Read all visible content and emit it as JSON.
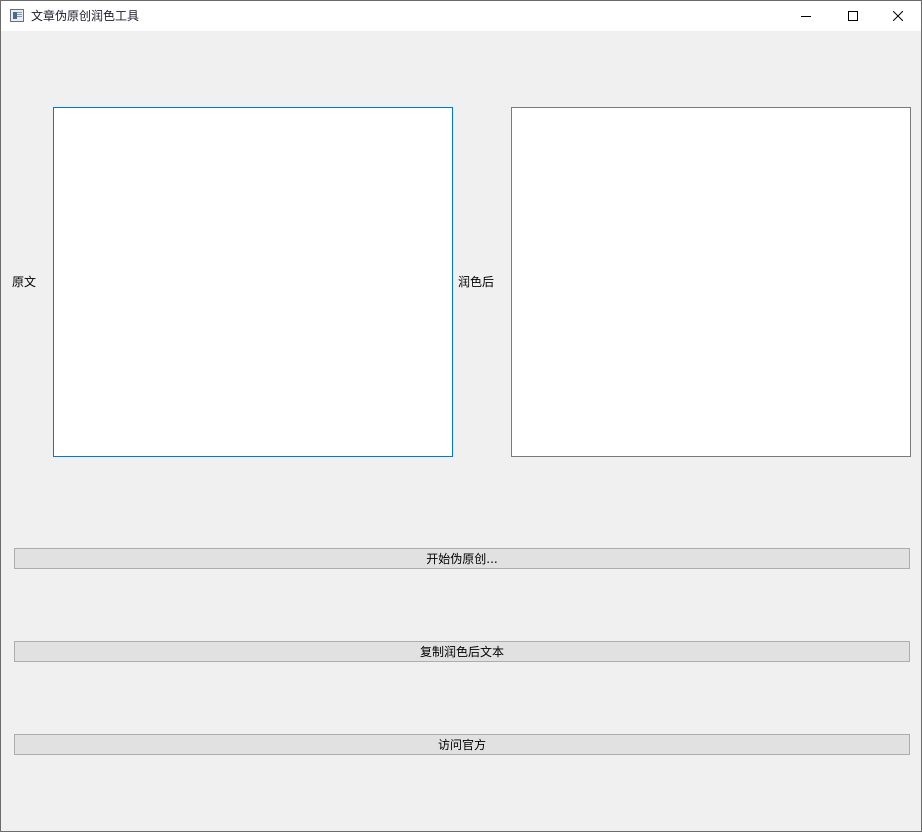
{
  "window": {
    "title": "文章伪原创润色工具",
    "icon": "app-window-icon",
    "controls": {
      "minimize_icon": "minimize-icon",
      "maximize_icon": "maximize-icon",
      "close_icon": "close-icon"
    }
  },
  "main": {
    "original_label": "原文",
    "original_text": "",
    "polished_label": "润色后",
    "polished_text": ""
  },
  "buttons": {
    "start_label": "开始伪原创...",
    "copy_label": "复制润色后文本",
    "visit_label": "访问官方"
  },
  "colors": {
    "focus_border": "#0078d7",
    "window_background": "#f0f0f0",
    "button_background": "#e1e1e1"
  }
}
